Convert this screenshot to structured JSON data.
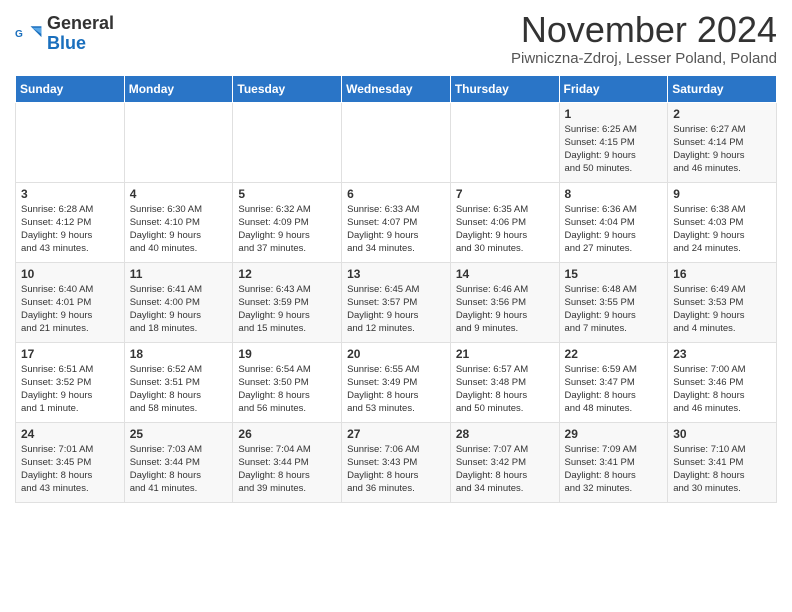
{
  "header": {
    "logo_general": "General",
    "logo_blue": "Blue",
    "month_title": "November 2024",
    "subtitle": "Piwniczna-Zdroj, Lesser Poland, Poland"
  },
  "weekdays": [
    "Sunday",
    "Monday",
    "Tuesday",
    "Wednesday",
    "Thursday",
    "Friday",
    "Saturday"
  ],
  "rows": [
    [
      {
        "day": "",
        "info": ""
      },
      {
        "day": "",
        "info": ""
      },
      {
        "day": "",
        "info": ""
      },
      {
        "day": "",
        "info": ""
      },
      {
        "day": "",
        "info": ""
      },
      {
        "day": "1",
        "info": "Sunrise: 6:25 AM\nSunset: 4:15 PM\nDaylight: 9 hours\nand 50 minutes."
      },
      {
        "day": "2",
        "info": "Sunrise: 6:27 AM\nSunset: 4:14 PM\nDaylight: 9 hours\nand 46 minutes."
      }
    ],
    [
      {
        "day": "3",
        "info": "Sunrise: 6:28 AM\nSunset: 4:12 PM\nDaylight: 9 hours\nand 43 minutes."
      },
      {
        "day": "4",
        "info": "Sunrise: 6:30 AM\nSunset: 4:10 PM\nDaylight: 9 hours\nand 40 minutes."
      },
      {
        "day": "5",
        "info": "Sunrise: 6:32 AM\nSunset: 4:09 PM\nDaylight: 9 hours\nand 37 minutes."
      },
      {
        "day": "6",
        "info": "Sunrise: 6:33 AM\nSunset: 4:07 PM\nDaylight: 9 hours\nand 34 minutes."
      },
      {
        "day": "7",
        "info": "Sunrise: 6:35 AM\nSunset: 4:06 PM\nDaylight: 9 hours\nand 30 minutes."
      },
      {
        "day": "8",
        "info": "Sunrise: 6:36 AM\nSunset: 4:04 PM\nDaylight: 9 hours\nand 27 minutes."
      },
      {
        "day": "9",
        "info": "Sunrise: 6:38 AM\nSunset: 4:03 PM\nDaylight: 9 hours\nand 24 minutes."
      }
    ],
    [
      {
        "day": "10",
        "info": "Sunrise: 6:40 AM\nSunset: 4:01 PM\nDaylight: 9 hours\nand 21 minutes."
      },
      {
        "day": "11",
        "info": "Sunrise: 6:41 AM\nSunset: 4:00 PM\nDaylight: 9 hours\nand 18 minutes."
      },
      {
        "day": "12",
        "info": "Sunrise: 6:43 AM\nSunset: 3:59 PM\nDaylight: 9 hours\nand 15 minutes."
      },
      {
        "day": "13",
        "info": "Sunrise: 6:45 AM\nSunset: 3:57 PM\nDaylight: 9 hours\nand 12 minutes."
      },
      {
        "day": "14",
        "info": "Sunrise: 6:46 AM\nSunset: 3:56 PM\nDaylight: 9 hours\nand 9 minutes."
      },
      {
        "day": "15",
        "info": "Sunrise: 6:48 AM\nSunset: 3:55 PM\nDaylight: 9 hours\nand 7 minutes."
      },
      {
        "day": "16",
        "info": "Sunrise: 6:49 AM\nSunset: 3:53 PM\nDaylight: 9 hours\nand 4 minutes."
      }
    ],
    [
      {
        "day": "17",
        "info": "Sunrise: 6:51 AM\nSunset: 3:52 PM\nDaylight: 9 hours\nand 1 minute."
      },
      {
        "day": "18",
        "info": "Sunrise: 6:52 AM\nSunset: 3:51 PM\nDaylight: 8 hours\nand 58 minutes."
      },
      {
        "day": "19",
        "info": "Sunrise: 6:54 AM\nSunset: 3:50 PM\nDaylight: 8 hours\nand 56 minutes."
      },
      {
        "day": "20",
        "info": "Sunrise: 6:55 AM\nSunset: 3:49 PM\nDaylight: 8 hours\nand 53 minutes."
      },
      {
        "day": "21",
        "info": "Sunrise: 6:57 AM\nSunset: 3:48 PM\nDaylight: 8 hours\nand 50 minutes."
      },
      {
        "day": "22",
        "info": "Sunrise: 6:59 AM\nSunset: 3:47 PM\nDaylight: 8 hours\nand 48 minutes."
      },
      {
        "day": "23",
        "info": "Sunrise: 7:00 AM\nSunset: 3:46 PM\nDaylight: 8 hours\nand 46 minutes."
      }
    ],
    [
      {
        "day": "24",
        "info": "Sunrise: 7:01 AM\nSunset: 3:45 PM\nDaylight: 8 hours\nand 43 minutes."
      },
      {
        "day": "25",
        "info": "Sunrise: 7:03 AM\nSunset: 3:44 PM\nDaylight: 8 hours\nand 41 minutes."
      },
      {
        "day": "26",
        "info": "Sunrise: 7:04 AM\nSunset: 3:44 PM\nDaylight: 8 hours\nand 39 minutes."
      },
      {
        "day": "27",
        "info": "Sunrise: 7:06 AM\nSunset: 3:43 PM\nDaylight: 8 hours\nand 36 minutes."
      },
      {
        "day": "28",
        "info": "Sunrise: 7:07 AM\nSunset: 3:42 PM\nDaylight: 8 hours\nand 34 minutes."
      },
      {
        "day": "29",
        "info": "Sunrise: 7:09 AM\nSunset: 3:41 PM\nDaylight: 8 hours\nand 32 minutes."
      },
      {
        "day": "30",
        "info": "Sunrise: 7:10 AM\nSunset: 3:41 PM\nDaylight: 8 hours\nand 30 minutes."
      }
    ]
  ]
}
